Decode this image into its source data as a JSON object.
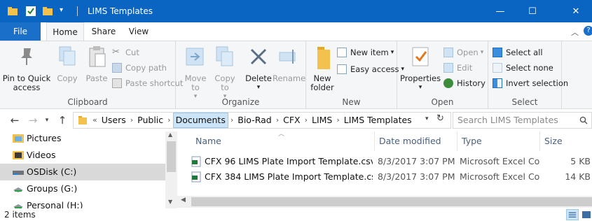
{
  "window": {
    "title": "LIMS Templates",
    "min_glyph": "—",
    "max_glyph": "☐",
    "close_glyph": "✕"
  },
  "tabs": [
    {
      "label": "File"
    },
    {
      "label": "Home"
    },
    {
      "label": "Share"
    },
    {
      "label": "View"
    }
  ],
  "ribbon": {
    "clipboard": {
      "group_label": "Clipboard",
      "pin": "Pin to Quick access",
      "copy": "Copy",
      "paste": "Paste",
      "cut": "Cut",
      "copy_path": "Copy path",
      "paste_shortcut": "Paste shortcut"
    },
    "organize": {
      "group_label": "Organize",
      "move_to": "Move to",
      "copy_to": "Copy to",
      "delete": "Delete",
      "rename": "Rename"
    },
    "new": {
      "group_label": "New",
      "new_folder": "New folder",
      "new_item": "New item",
      "easy_access": "Easy access"
    },
    "open": {
      "group_label": "Open",
      "properties": "Properties",
      "open": "Open",
      "edit": "Edit",
      "history": "History"
    },
    "select": {
      "group_label": "Select",
      "select_all": "Select all",
      "select_none": "Select none",
      "invert_selection": "Invert selection"
    }
  },
  "address": {
    "breadcrumbs": [
      "Users",
      "Public",
      "Documents",
      "Bio-Rad",
      "CFX",
      "LIMS",
      "LIMS Templates"
    ],
    "search_placeholder": "Search LIMS Templates"
  },
  "nav_pane": {
    "items": [
      {
        "label": "Pictures",
        "icon": "pictures-folder-icon"
      },
      {
        "label": "Videos",
        "icon": "videos-folder-icon"
      },
      {
        "label": "OSDisk (C:)",
        "icon": "drive-icon",
        "selected": true
      },
      {
        "label": "Groups (G:)",
        "icon": "network-drive-icon"
      },
      {
        "label": "Personal (H:)",
        "icon": "network-drive-icon"
      }
    ]
  },
  "file_list": {
    "columns": [
      "Name",
      "Date modified",
      "Type",
      "Size"
    ],
    "rows": [
      {
        "name": "CFX 96 LIMS Plate Import Template.csv",
        "date": "8/3/2017 3:07 PM",
        "type": "Microsoft Excel Co...",
        "size": "5 KB"
      },
      {
        "name": "CFX 384 LIMS Plate Import Template.csv",
        "date": "8/3/2017 3:07 PM",
        "type": "Microsoft Excel Co...",
        "size": "14 KB"
      }
    ]
  },
  "status": {
    "item_count": "2 items"
  },
  "colors": {
    "titlebar": "#0a64c2",
    "folder": "#f2c14e",
    "accent": "#1a6fc9"
  }
}
